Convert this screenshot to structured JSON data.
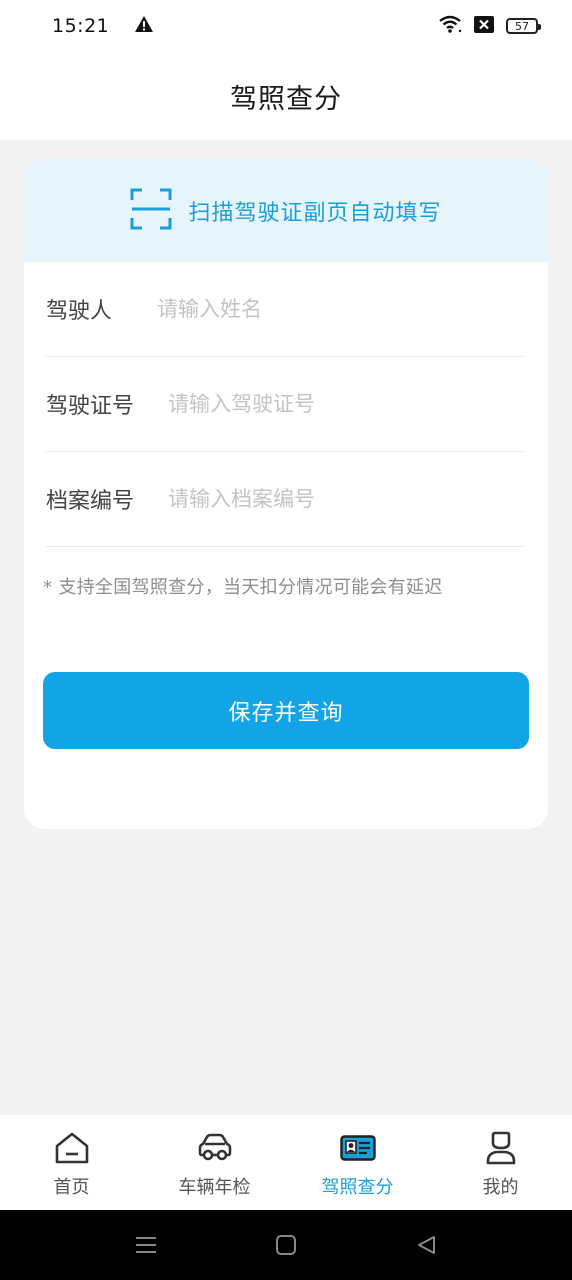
{
  "status_bar": {
    "time": "15:21",
    "battery": "57",
    "icons": [
      "warning-icon",
      "wifi-icon",
      "sim-off-icon",
      "battery-icon"
    ]
  },
  "header": {
    "title": "驾照查分"
  },
  "scan": {
    "label": "扫描驾驶证副页自动填写",
    "icon": "scan-icon"
  },
  "form": {
    "driver": {
      "label": "驾驶人",
      "placeholder": "请输入姓名",
      "value": ""
    },
    "license": {
      "label": "驾驶证号",
      "placeholder": "请输入驾驶证号",
      "value": ""
    },
    "file_no": {
      "label": "档案编号",
      "placeholder": "请输入档案编号",
      "value": ""
    },
    "hint": "* 支持全国驾照查分，当天扣分情况可能会有延迟",
    "submit_label": "保存并查询"
  },
  "tabs": [
    {
      "label": "首页",
      "icon": "home-icon",
      "active": false
    },
    {
      "label": "车辆年检",
      "icon": "car-icon",
      "active": false
    },
    {
      "label": "驾照查分",
      "icon": "license-card-icon",
      "active": true
    },
    {
      "label": "我的",
      "icon": "profile-icon",
      "active": false
    }
  ],
  "colors": {
    "accent": "#12a4e6",
    "accent_text": "#1a9fd8",
    "banner_bg": "#e6f4fb",
    "page_bg": "#f2f2f2"
  }
}
